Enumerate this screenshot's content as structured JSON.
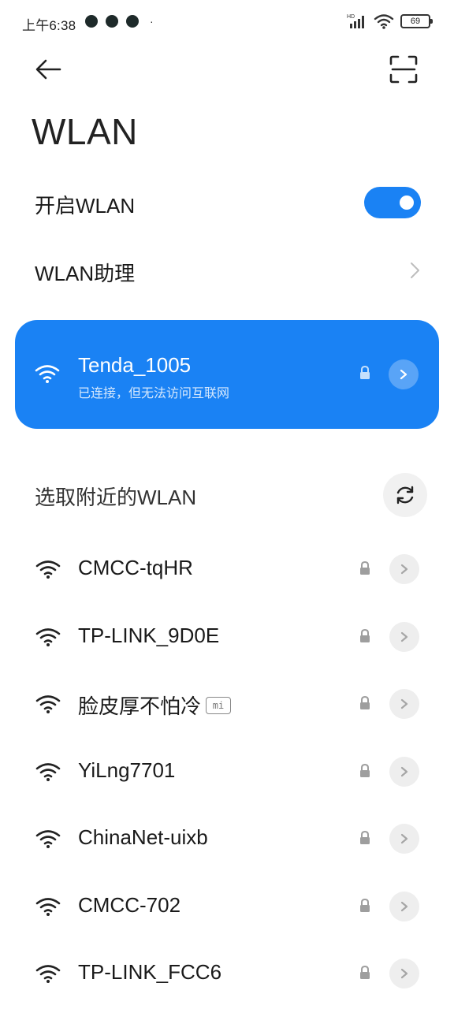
{
  "status_bar": {
    "time": "上午6:38",
    "more_indicator": "·",
    "signal_label": "HD",
    "battery": "69",
    "icons": [
      "notification-icon",
      "notification-icon",
      "notification-icon",
      "signal-icon",
      "wifi-icon",
      "battery-icon"
    ]
  },
  "header": {
    "back_icon": "arrow-left-icon",
    "scan_icon": "scan-icon",
    "title": "WLAN"
  },
  "settings": {
    "enable_wlan_label": "开启WLAN",
    "enable_wlan_on": true,
    "assistant_label": "WLAN助理"
  },
  "connected": {
    "ssid": "Tenda_1005",
    "status": "已连接，但无法访问互联网",
    "secured": true
  },
  "nearby": {
    "label": "选取附近的WLAN",
    "networks": [
      {
        "ssid": "CMCC-tqHR",
        "badge": "",
        "secured": true
      },
      {
        "ssid": "TP-LINK_9D0E",
        "badge": "",
        "secured": true
      },
      {
        "ssid": "脸皮厚不怕冷",
        "badge": "mi",
        "secured": true
      },
      {
        "ssid": "YiLng7701",
        "badge": "",
        "secured": true
      },
      {
        "ssid": "ChinaNet-uixb",
        "badge": "",
        "secured": true
      },
      {
        "ssid": "CMCC-702",
        "badge": "",
        "secured": true
      },
      {
        "ssid": "TP-LINK_FCC6",
        "badge": "",
        "secured": true
      }
    ]
  },
  "colors": {
    "accent": "#1a82f4",
    "background": "#ffffff",
    "text": "#1a1a1a"
  }
}
